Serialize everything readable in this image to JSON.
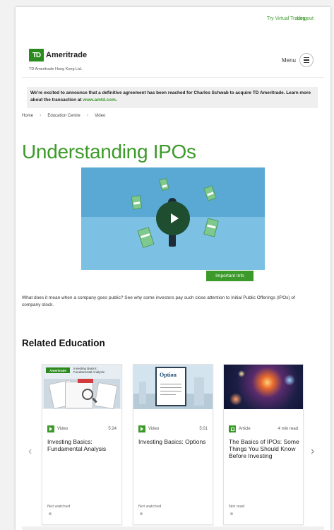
{
  "topbar": {
    "virtual_trading": "Try Virtual Trading",
    "logout": "Log out"
  },
  "brand": {
    "logo_mark": "TD",
    "logo_word": "Ameritrade",
    "subtitle": "TD Ameritrade Hong Kong Ltd."
  },
  "menu": {
    "label": "Menu"
  },
  "notice": {
    "text": "We’re excited to announce that a definitive agreement has been reached for Charles Schwab to acquire TD Ameritrade. Learn more about the transaction at ",
    "link": "www.amtd.com",
    "end": "."
  },
  "breadcrumb": [
    "Home",
    "Education Centre",
    "Video"
  ],
  "page_title": "Understanding IPOs",
  "video": {
    "button_label": "Important Info"
  },
  "description": "What does it mean when a company goes public? See why some investors pay such close attention to Initial Public Offerings (IPOs) of company stock.",
  "related": {
    "heading": "Related Education",
    "cards": [
      {
        "type": "Video",
        "duration": "5:24",
        "title": "Investing Basics: Fundamental Analysis",
        "status": "Not watched",
        "thumb_brand": "Ameritrade",
        "thumb_caption": "Investing Basics: Fundamental Analysis"
      },
      {
        "type": "Video",
        "duration": "5:01",
        "title": "Investing Basics: Options",
        "status": "Not watched",
        "thumb_text": "Option"
      },
      {
        "type": "Article",
        "duration": "4 min read",
        "title": "The Basics of IPOs: Some Things You Should Know Before Investing",
        "status": "Not read"
      }
    ]
  }
}
